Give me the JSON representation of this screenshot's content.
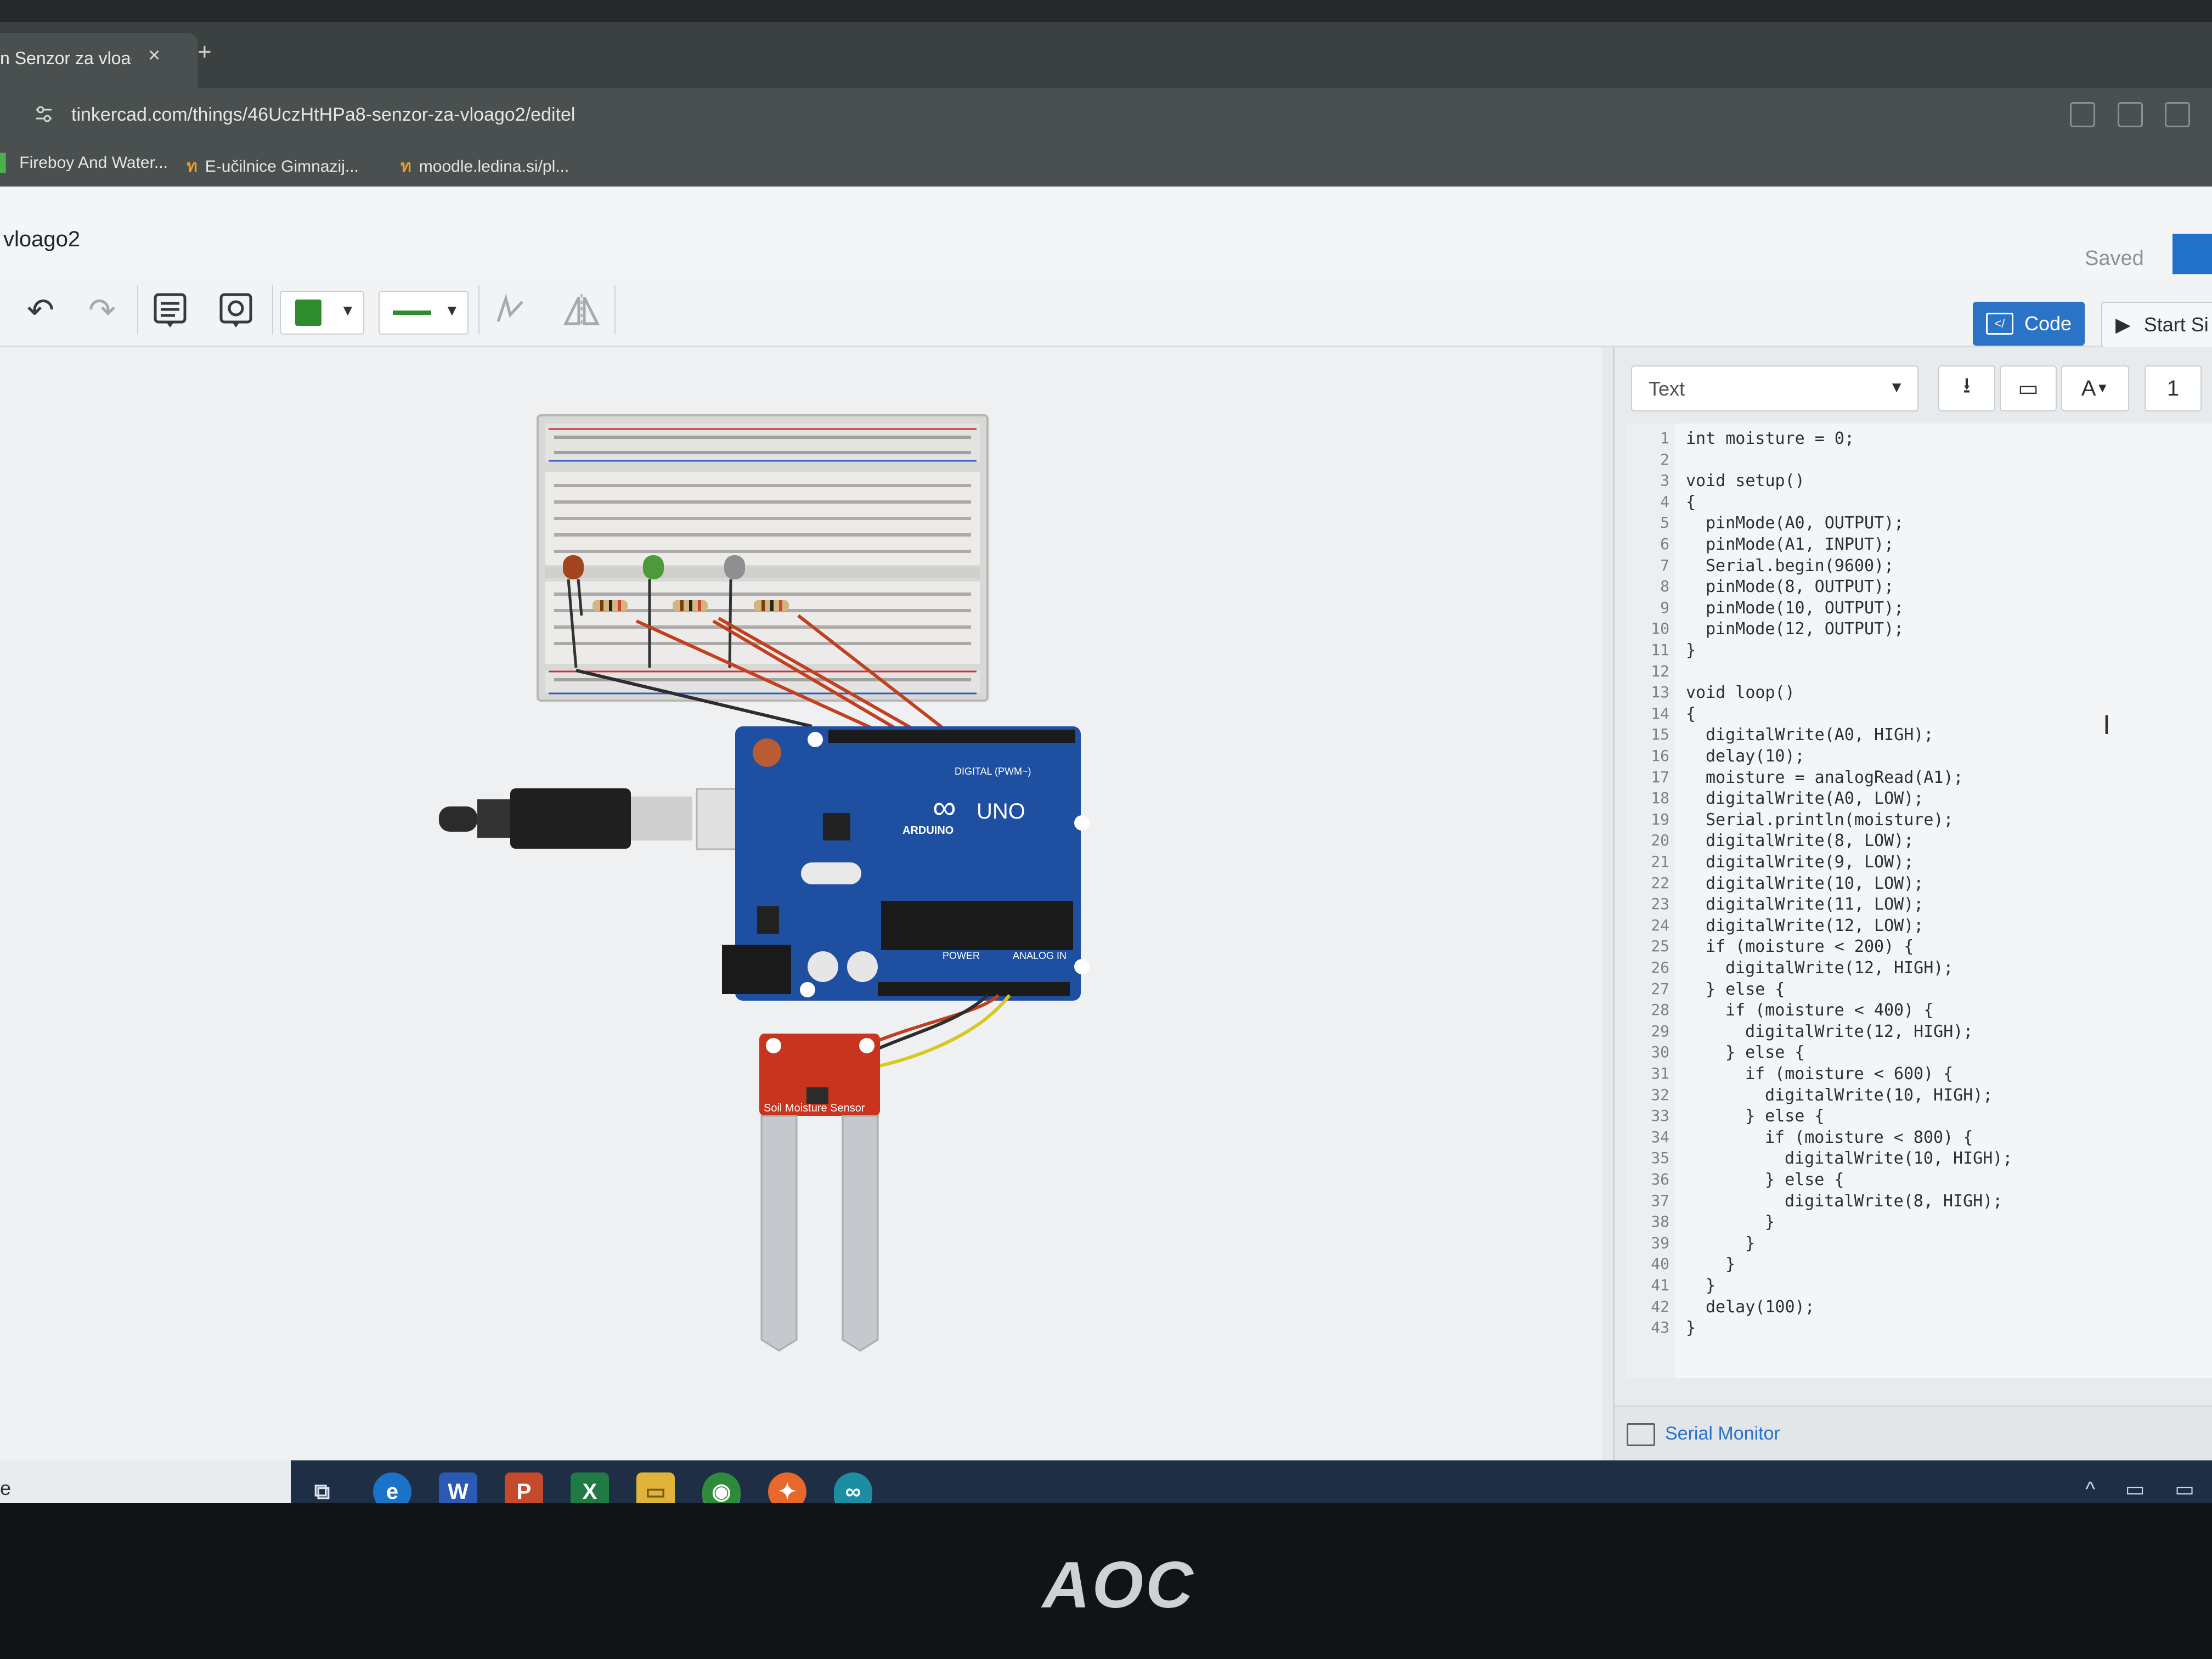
{
  "browser": {
    "tab_title": "n Senzor za vloag",
    "tab_close": "×",
    "new_tab": "+",
    "url": "tinkercad.com/things/46UczHtHPa8-senzor-za-vloago2/editel",
    "bookmarks": [
      {
        "label": "Fireboy And Water..."
      },
      {
        "label": "E-učilnice Gimnazij..."
      },
      {
        "label": "moodle.ledina.si/pl..."
      }
    ]
  },
  "app": {
    "project_name": "vloago2",
    "save_status": "Saved"
  },
  "toolbar": {
    "code_label": "Code",
    "start_label": "Start Si",
    "accent_color": "#2b73c7",
    "wire_color": "#2e8b2e"
  },
  "circuit": {
    "board": {
      "logo": "∞",
      "brand": "ARDUINO",
      "model": "UNO",
      "digital_label": "DIGITAL (PWM~)",
      "power_label": "POWER",
      "analog_label": "ANALOG IN"
    },
    "sensor_label": "Soil Moisture Sensor"
  },
  "code_panel": {
    "mode": "Text",
    "font_btn": "A",
    "cut_label": "1",
    "lines": [
      {
        "n": "1",
        "text": "int moisture = 0;",
        "indent": 0
      },
      {
        "n": "2",
        "text": "",
        "indent": 0
      },
      {
        "n": "3",
        "text": "void setup()",
        "indent": 0
      },
      {
        "n": "4",
        "text": "{",
        "indent": 0
      },
      {
        "n": "5",
        "text": "pinMode(A0, OUTPUT);",
        "indent": 1
      },
      {
        "n": "6",
        "text": "pinMode(A1, INPUT);",
        "indent": 1
      },
      {
        "n": "7",
        "text": "Serial.begin(9600);",
        "indent": 1
      },
      {
        "n": "8",
        "text": "pinMode(8, OUTPUT);",
        "indent": 1
      },
      {
        "n": "9",
        "text": "pinMode(10, OUTPUT);",
        "indent": 1
      },
      {
        "n": "10",
        "text": "pinMode(12, OUTPUT);",
        "indent": 1
      },
      {
        "n": "11",
        "text": "}",
        "indent": 0
      },
      {
        "n": "12",
        "text": "",
        "indent": 0
      },
      {
        "n": "13",
        "text": "void loop()",
        "indent": 0
      },
      {
        "n": "14",
        "text": "{",
        "indent": 0
      },
      {
        "n": "15",
        "text": "digitalWrite(A0, HIGH);",
        "indent": 1
      },
      {
        "n": "16",
        "text": "delay(10);",
        "indent": 1
      },
      {
        "n": "17",
        "text": "moisture = analogRead(A1);",
        "indent": 1
      },
      {
        "n": "18",
        "text": "digitalWrite(A0, LOW);",
        "indent": 1
      },
      {
        "n": "19",
        "text": "Serial.println(moisture);",
        "indent": 1
      },
      {
        "n": "20",
        "text": "digitalWrite(8, LOW);",
        "indent": 1
      },
      {
        "n": "21",
        "text": "digitalWrite(9, LOW);",
        "indent": 1
      },
      {
        "n": "22",
        "text": "digitalWrite(10, LOW);",
        "indent": 1
      },
      {
        "n": "23",
        "text": "digitalWrite(11, LOW);",
        "indent": 1
      },
      {
        "n": "24",
        "text": "digitalWrite(12, LOW);",
        "indent": 1
      },
      {
        "n": "25",
        "text": "if (moisture < 200) {",
        "indent": 1
      },
      {
        "n": "26",
        "text": "digitalWrite(12, HIGH);",
        "indent": 2
      },
      {
        "n": "27",
        "text": "} else {",
        "indent": 1
      },
      {
        "n": "28",
        "text": "if (moisture < 400) {",
        "indent": 2
      },
      {
        "n": "29",
        "text": "digitalWrite(12, HIGH);",
        "indent": 3
      },
      {
        "n": "30",
        "text": "} else {",
        "indent": 2
      },
      {
        "n": "31",
        "text": "if (moisture < 600) {",
        "indent": 3
      },
      {
        "n": "32",
        "text": "digitalWrite(10, HIGH);",
        "indent": 4
      },
      {
        "n": "33",
        "text": "} else {",
        "indent": 3
      },
      {
        "n": "34",
        "text": "if (moisture < 800) {",
        "indent": 4
      },
      {
        "n": "35",
        "text": "digitalWrite(10, HIGH);",
        "indent": 5
      },
      {
        "n": "36",
        "text": "} else {",
        "indent": 4
      },
      {
        "n": "37",
        "text": "digitalWrite(8, HIGH);",
        "indent": 5
      },
      {
        "n": "38",
        "text": "}",
        "indent": 4
      },
      {
        "n": "39",
        "text": "}",
        "indent": 3
      },
      {
        "n": "40",
        "text": "}",
        "indent": 2
      },
      {
        "n": "41",
        "text": "}",
        "indent": 1
      },
      {
        "n": "42",
        "text": "delay(100);",
        "indent": 1
      },
      {
        "n": "43",
        "text": "}",
        "indent": 0
      }
    ],
    "serial_monitor_label": "Serial Monitor"
  },
  "taskbar": {
    "left_text": "e",
    "apps": [
      {
        "icon": "task-view-icon",
        "glyph": "⧉"
      },
      {
        "icon": "edge-icon",
        "glyph": "e"
      },
      {
        "icon": "word-icon",
        "glyph": "W"
      },
      {
        "icon": "powerpoint-icon",
        "glyph": "P"
      },
      {
        "icon": "excel-icon",
        "glyph": "X"
      },
      {
        "icon": "file-explorer-icon",
        "glyph": "▭"
      },
      {
        "icon": "chrome-icon",
        "glyph": "◉"
      },
      {
        "icon": "firefox-icon",
        "glyph": "✦"
      },
      {
        "icon": "arduino-ide-icon",
        "glyph": "∞"
      }
    ],
    "tray": "^ ▭ ▭"
  },
  "monitor": {
    "brand": "AOC"
  }
}
